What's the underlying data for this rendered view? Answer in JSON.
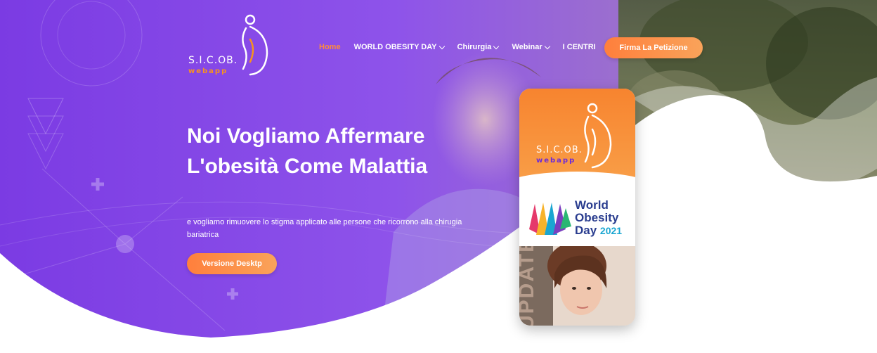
{
  "logo": {
    "title": "S.I.C.OB.",
    "sub": "webapp"
  },
  "nav": {
    "items": [
      {
        "label": "Home",
        "active": true,
        "dropdown": false
      },
      {
        "label": "WORLD OBESITY DAY",
        "active": false,
        "dropdown": true
      },
      {
        "label": "Chirurgia",
        "active": false,
        "dropdown": true
      },
      {
        "label": "Webinar",
        "active": false,
        "dropdown": true
      },
      {
        "label": "I CENTRI",
        "active": false,
        "dropdown": false
      }
    ],
    "cta": "Firma La Petizione"
  },
  "hero": {
    "title": "Noi Vogliamo Affermare L'obesità Come Malattia",
    "subtitle": "e vogliamo rimuovere lo stigma applicato alle persone che ricorrono alla chirugia bariatrica",
    "cta": "Versione Desktp"
  },
  "phone": {
    "logo_title": "S.I.C.OB.",
    "logo_sub": "webapp",
    "wod_line1": "World",
    "wod_line2": "Obesity",
    "wod_line3": "Day",
    "wod_year": "2021",
    "banner_text": "UPDATE"
  },
  "colors": {
    "purple_dark": "#6a2fd6",
    "purple_light": "#a77ff0",
    "orange": "#f7842f",
    "active_nav": "#ff8a3d"
  }
}
